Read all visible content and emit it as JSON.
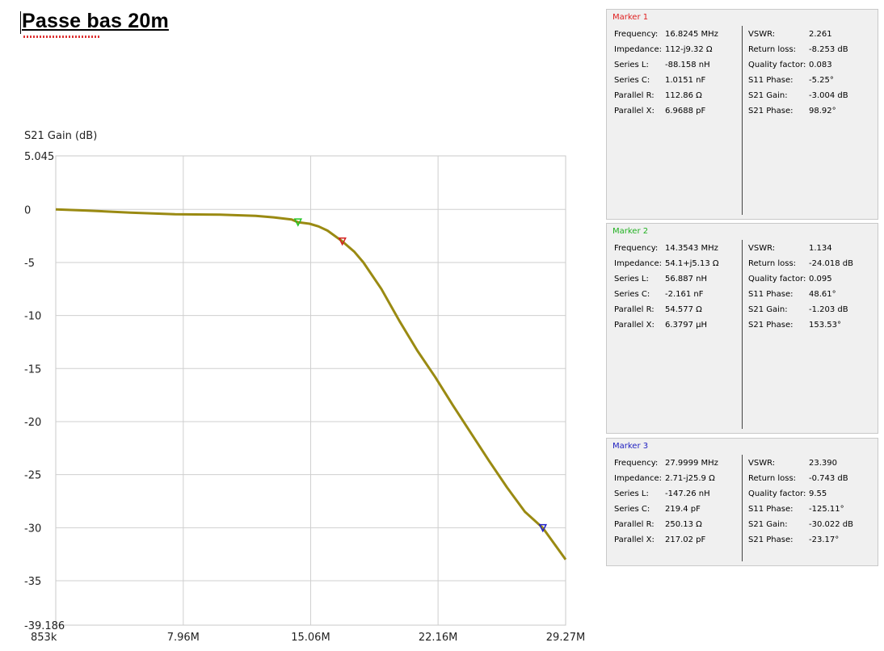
{
  "document": {
    "title": "Passe bas 20m"
  },
  "chart_data": {
    "type": "line",
    "title": "",
    "ylabel": "S21 Gain (dB)",
    "xlabel": "",
    "xlim_mhz": [
      0.853,
      29.27
    ],
    "ylim": [
      -39.186,
      5.045
    ],
    "y_ticks": [
      5.045,
      0,
      -5,
      -10,
      -15,
      -20,
      -25,
      -30,
      -35,
      -39.186
    ],
    "y_tick_labels": [
      "5.045",
      "0",
      "-5",
      "-10",
      "-15",
      "-20",
      "-25",
      "-30",
      "-35",
      "-39.186"
    ],
    "x_ticks_mhz": [
      0.853,
      7.96,
      15.06,
      22.16,
      29.27
    ],
    "x_tick_labels": [
      "853k",
      "7.96M",
      "15.06M",
      "22.16M",
      "29.27M"
    ],
    "grid": true,
    "line_color": "#9a8a12",
    "series": [
      {
        "x_mhz": [
          0.853,
          2.5,
          5.0,
          7.5,
          10.0,
          12.0,
          13.0,
          14.0,
          14.35,
          15.0,
          15.5,
          16.0,
          16.82,
          17.5,
          18.0,
          19.0,
          20.0,
          21.0,
          22.0,
          23.0,
          24.0,
          25.0,
          26.0,
          27.0,
          28.0,
          29.27
        ],
        "y_db": [
          0.0,
          -0.1,
          -0.3,
          -0.45,
          -0.5,
          -0.6,
          -0.75,
          -0.95,
          -1.203,
          -1.35,
          -1.6,
          -2.0,
          -3.004,
          -4.0,
          -5.0,
          -7.5,
          -10.5,
          -13.3,
          -15.8,
          -18.5,
          -21.1,
          -23.7,
          -26.2,
          -28.5,
          -30.022,
          -33.0
        ]
      }
    ],
    "markers": [
      {
        "name": "Marker 1",
        "x_mhz": 16.8245,
        "y_db": -3.004,
        "color": "#d42020"
      },
      {
        "name": "Marker 2",
        "x_mhz": 14.3543,
        "y_db": -1.203,
        "color": "#22c322"
      },
      {
        "name": "Marker 3",
        "x_mhz": 27.9999,
        "y_db": -30.022,
        "color": "#2020c8"
      }
    ]
  },
  "marker_panels": [
    {
      "title": "Marker 1",
      "title_color": "#e02020",
      "left": [
        {
          "label": "Frequency:",
          "value": "16.8245 MHz"
        },
        {
          "label": "Impedance:",
          "value": "112-j9.32 Ω"
        },
        {
          "label": "Series L:",
          "value": "-88.158 nH"
        },
        {
          "label": "Series C:",
          "value": "1.0151 nF"
        },
        {
          "label": "Parallel R:",
          "value": "112.86 Ω"
        },
        {
          "label": "Parallel X:",
          "value": "6.9688 pF"
        }
      ],
      "right": [
        {
          "label": "VSWR:",
          "value": "2.261"
        },
        {
          "label": "Return loss:",
          "value": "-8.253 dB"
        },
        {
          "label": "Quality factor:",
          "value": "0.083"
        },
        {
          "label": "S11 Phase:",
          "value": "-5.25°"
        },
        {
          "label": "S21 Gain:",
          "value": "-3.004 dB"
        },
        {
          "label": "S21 Phase:",
          "value": "98.92°"
        }
      ]
    },
    {
      "title": "Marker 2",
      "title_color": "#20b020",
      "left": [
        {
          "label": "Frequency:",
          "value": "14.3543 MHz"
        },
        {
          "label": "Impedance:",
          "value": "54.1+j5.13 Ω"
        },
        {
          "label": "Series L:",
          "value": "56.887 nH"
        },
        {
          "label": "Series C:",
          "value": "-2.161 nF"
        },
        {
          "label": "Parallel R:",
          "value": "54.577 Ω"
        },
        {
          "label": "Parallel X:",
          "value": "6.3797 µH"
        }
      ],
      "right": [
        {
          "label": "VSWR:",
          "value": "1.134"
        },
        {
          "label": "Return loss:",
          "value": "-24.018 dB"
        },
        {
          "label": "Quality factor:",
          "value": "0.095"
        },
        {
          "label": "S11 Phase:",
          "value": "48.61°"
        },
        {
          "label": "S21 Gain:",
          "value": "-1.203 dB"
        },
        {
          "label": "S21 Phase:",
          "value": "153.53°"
        }
      ]
    },
    {
      "title": "Marker 3",
      "title_color": "#2020c0",
      "left": [
        {
          "label": "Frequency:",
          "value": "27.9999 MHz"
        },
        {
          "label": "Impedance:",
          "value": "2.71-j25.9 Ω"
        },
        {
          "label": "Series L:",
          "value": "-147.26 nH"
        },
        {
          "label": "Series C:",
          "value": "219.4 pF"
        },
        {
          "label": "Parallel R:",
          "value": "250.13 Ω"
        },
        {
          "label": "Parallel X:",
          "value": "217.02 pF"
        }
      ],
      "right": [
        {
          "label": "VSWR:",
          "value": "23.390"
        },
        {
          "label": "Return loss:",
          "value": "-0.743 dB"
        },
        {
          "label": "Quality factor:",
          "value": "9.55"
        },
        {
          "label": "S11 Phase:",
          "value": "-125.11°"
        },
        {
          "label": "S21 Gain:",
          "value": "-30.022 dB"
        },
        {
          "label": "S21 Phase:",
          "value": "-23.17°"
        }
      ]
    }
  ]
}
